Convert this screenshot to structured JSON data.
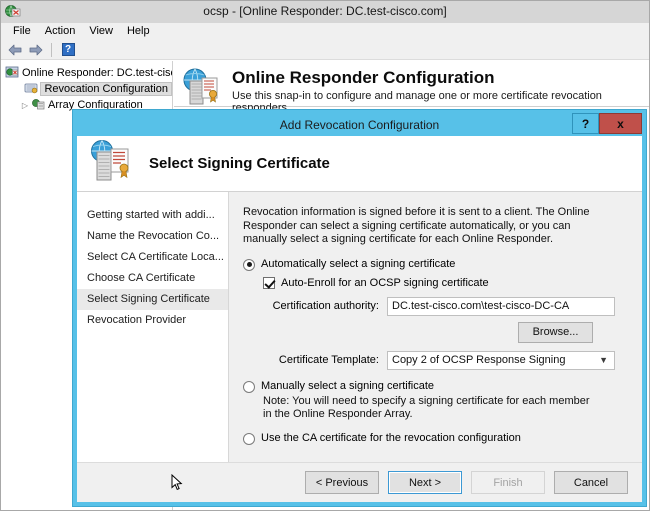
{
  "window": {
    "title": "ocsp - [Online Responder: DC.test-cisco.com]",
    "app_icon": "online-responder-icon",
    "menus": [
      "File",
      "Action",
      "View",
      "Help"
    ],
    "toolbar": {
      "back": "back-arrow-icon",
      "forward": "forward-arrow-icon",
      "help": "?"
    }
  },
  "tree": {
    "root": "Online Responder: DC.test-cisco.co",
    "items": [
      {
        "label": "Revocation Configuration",
        "selected": true,
        "expander": ""
      },
      {
        "label": "Array Configuration",
        "selected": false,
        "expander": "▷"
      }
    ]
  },
  "details": {
    "title": "Online Responder Configuration",
    "subtitle": "Use this snap-in to configure and manage one or more certificate revocation responders."
  },
  "dialog": {
    "title": "Add Revocation Configuration",
    "help_button": "?",
    "close_button": "x",
    "banner_title": "Select Signing Certificate",
    "steps": [
      {
        "label": "Getting started with addi...",
        "active": false
      },
      {
        "label": "Name the Revocation Co...",
        "active": false
      },
      {
        "label": "Select CA Certificate Loca...",
        "active": false
      },
      {
        "label": "Choose CA Certificate",
        "active": false
      },
      {
        "label": "Select Signing Certificate",
        "active": true
      },
      {
        "label": "Revocation Provider",
        "active": false
      }
    ],
    "intro": "Revocation information is signed before it is sent to a client. The Online Responder can select a signing certificate automatically, or you can manually select a signing certificate for each Online Responder.",
    "option_auto": "Automatically select a signing certificate",
    "checkbox_autoenroll": "Auto-Enroll for an OCSP signing certificate",
    "label_ca": "Certification authority:",
    "value_ca": "DC.test-cisco.com\\test-cisco-DC-CA",
    "browse_button": "Browse...",
    "label_template": "Certificate Template:",
    "value_template": "Copy 2 of OCSP Response Signing",
    "template_options": [
      "Copy 2 of OCSP Response Signing"
    ],
    "option_manual": "Manually select a signing certificate",
    "note_manual": "Note: You will need to specify a signing certificate for each member in the Online Responder Array.",
    "option_use_ca": "Use the CA certificate for the revocation configuration",
    "buttons": {
      "previous": "< Previous",
      "next": "Next >",
      "finish": "Finish",
      "cancel": "Cancel"
    }
  },
  "colors": {
    "dialog_border": "#57c1e8",
    "close_button": "#c0504a",
    "default_button_outline": "#3c99d4"
  }
}
